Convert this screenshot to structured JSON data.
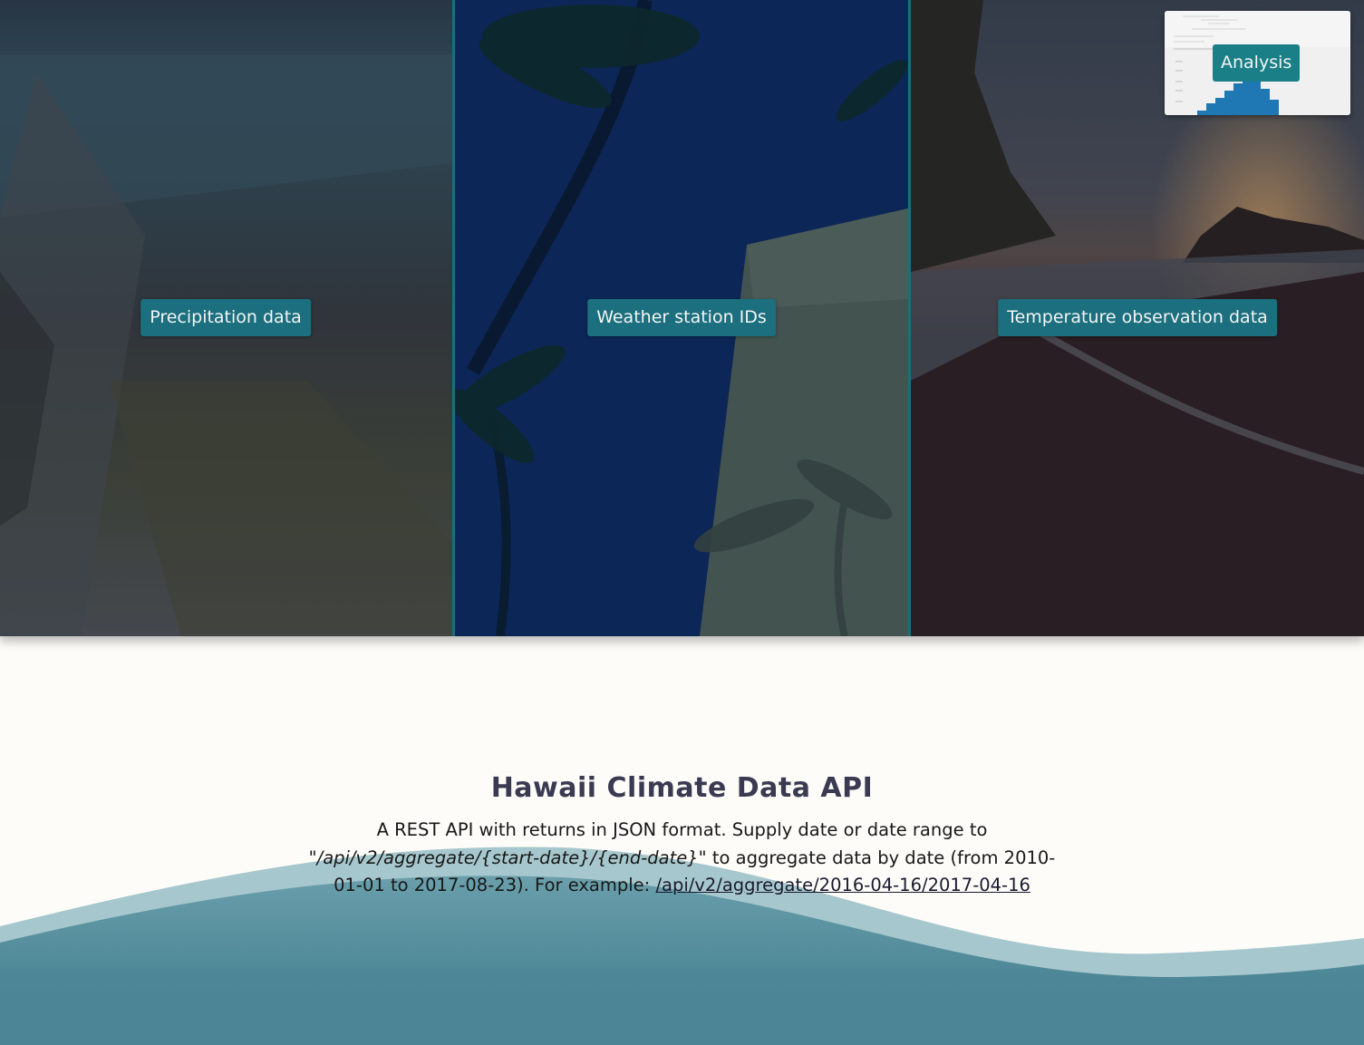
{
  "hero": {
    "panels": [
      {
        "label": "Precipitation data"
      },
      {
        "label": "Weather station IDs"
      },
      {
        "label": "Temperature observation data"
      }
    ],
    "analysis": {
      "label": "Analysis"
    }
  },
  "main": {
    "title": "Hawaii Climate Data API",
    "desc_part1": "A REST API with returns in JSON format. Supply date or date range to ",
    "desc_endpoint": "\"/api/v2/aggregate/{start-date}/{end-date}\"",
    "desc_part2": " to aggregate data by date (from 2010-01-01 to 2017-08-23). For example: ",
    "example_link": "/api/v2/aggregate/2016-04-16/2017-04-16"
  },
  "colors": {
    "accent": "#1b6f7e",
    "wave_dark": "#4c8797",
    "wave_light": "#a3c5cb",
    "page_bg": "#fdfcf8"
  }
}
